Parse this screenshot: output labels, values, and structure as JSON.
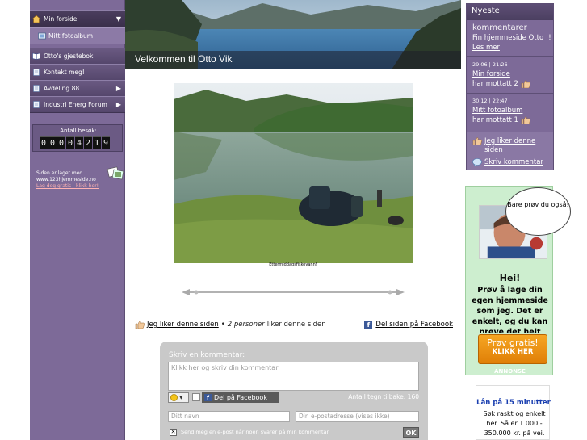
{
  "colors": {
    "sidebar_bg": "#7d6a98",
    "nav_bg": "#55476c",
    "ad_bg": "#cdeecf",
    "cta_orange": "#f6a623",
    "facebook_blue": "#3b5998",
    "loan_title_blue": "#1a3fb0"
  },
  "sidebar": {
    "items": [
      {
        "label": "Min forside",
        "icon": "home-icon",
        "arrow": "▼"
      },
      {
        "label": "Mitt fotoalbum",
        "icon": "photo-icon"
      },
      {
        "label": "Otto's gjestebok",
        "icon": "book-icon"
      },
      {
        "label": "Kontakt meg!",
        "icon": "page-icon"
      },
      {
        "label": "Avdeling 88",
        "icon": "page-icon",
        "arrow": "▶"
      },
      {
        "label": "Industri Energ Forum",
        "icon": "page-icon",
        "arrow": "▶"
      }
    ],
    "counter": {
      "label": "Antall besøk:",
      "digits": [
        "0",
        "0",
        "0",
        "0",
        "4",
        "2",
        "1",
        "9"
      ]
    },
    "made_with": {
      "line1": "Siden er laget med",
      "site": "www.123hjemmeside.no",
      "link": "Lag deg gratis - klikk her!"
    }
  },
  "main": {
    "header_title": "Velkommen til Otto Vik",
    "photo_caption": "Ettermiddagsfiskevann!",
    "like": {
      "link": "Jeg liker denne siden",
      "separator": "•",
      "count_text": "2 personer",
      "suffix": "liker denne siden"
    },
    "share_facebook": "Del siden på Facebook",
    "comment_form": {
      "title": "Skriv en kommentar:",
      "textarea_placeholder": "Klikk her og skriv din kommentar",
      "fb_share_label": "Del på Facebook",
      "char_count": "Antall tegn tilbake: 160",
      "name_placeholder": "Ditt navn",
      "email_placeholder": "Din e-postadresse (vises ikke)",
      "notify_checked": true,
      "notify_label": "Send meg en e-post når noen svarer på min kommentar.",
      "submit_label": "OK"
    }
  },
  "right": {
    "newest": {
      "title": "Nyeste",
      "subtitle": "kommentarer",
      "items": [
        {
          "stamp": "",
          "line1": "Fin hjemmeside Otto !!",
          "line2": "Les mer"
        },
        {
          "stamp": "29.06 | 21:26",
          "line1": "Min forside",
          "line2": "har mottatt 2"
        },
        {
          "stamp": "30.12 | 22:47",
          "line1": "Mitt fotoalbum",
          "line2": "har mottatt 1"
        }
      ],
      "like_link": "Jeg liker denne siden",
      "write_comment": "Skriv kommentar"
    },
    "ad": {
      "bubble": "Bare prøv du også!",
      "hei": "Hei!",
      "text": "Prøv å lage din egen hjemmeside som jeg. Det er enkelt, og du kan prøve det helt gratis.",
      "cta_line1": "Prøv gratis!",
      "cta_line2": "KLIKK HER",
      "footer": "ANNONSE"
    },
    "loan": {
      "title": "Lån på 15 minutter",
      "text": "Søk raskt og enkelt her. Så er 1.000 - 350.000 kr. på vei."
    }
  }
}
